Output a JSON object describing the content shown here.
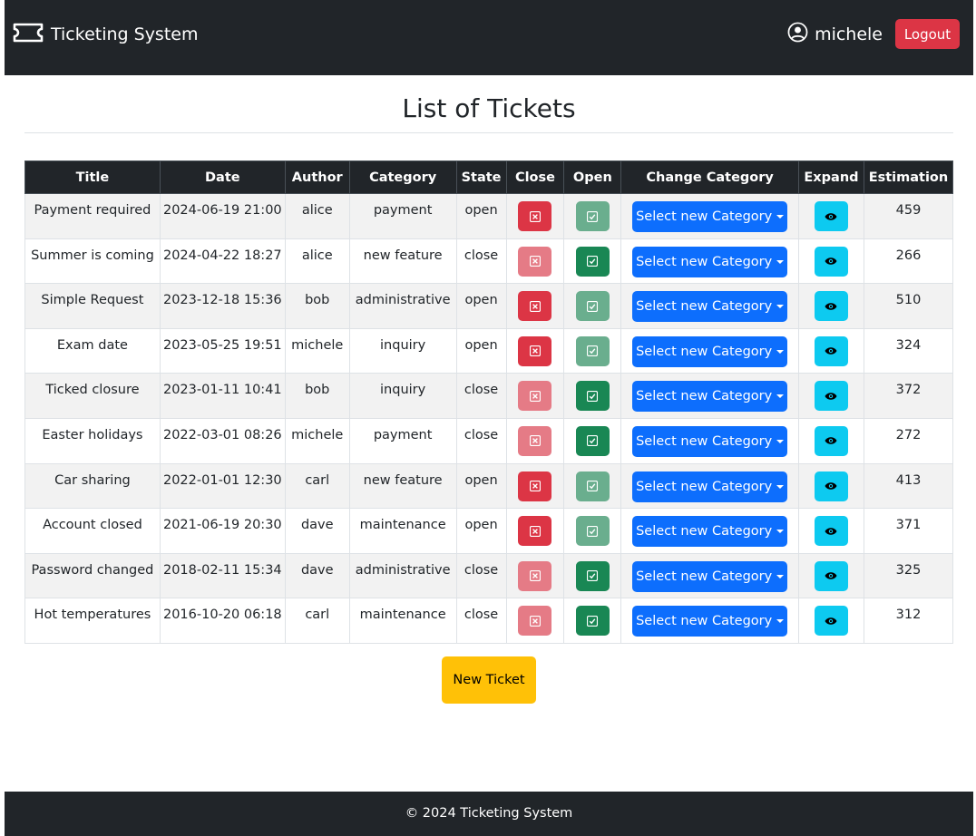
{
  "navbar": {
    "brand": "Ticketing System",
    "brand_icon": "ticket-icon",
    "user_icon": "person-circle-icon",
    "username": "michele",
    "logout_label": "Logout"
  },
  "page": {
    "title": "List of Tickets"
  },
  "table": {
    "headers": [
      "Title",
      "Date",
      "Author",
      "Category",
      "State",
      "Close",
      "Open",
      "Change Category",
      "Expand",
      "Estimation"
    ],
    "category_button_label": "Select new Category",
    "rows": [
      {
        "title": "Payment required",
        "date": "2024-06-19 21:00",
        "author": "alice",
        "category": "payment",
        "state": "open",
        "estimation": "459"
      },
      {
        "title": "Summer is coming",
        "date": "2024-04-22 18:27",
        "author": "alice",
        "category": "new feature",
        "state": "close",
        "estimation": "266"
      },
      {
        "title": "Simple Request",
        "date": "2023-12-18 15:36",
        "author": "bob",
        "category": "administrative",
        "state": "open",
        "estimation": "510"
      },
      {
        "title": "Exam date",
        "date": "2023-05-25 19:51",
        "author": "michele",
        "category": "inquiry",
        "state": "open",
        "estimation": "324"
      },
      {
        "title": "Ticked closure",
        "date": "2023-01-11 10:41",
        "author": "bob",
        "category": "inquiry",
        "state": "close",
        "estimation": "372"
      },
      {
        "title": "Easter holidays",
        "date": "2022-03-01 08:26",
        "author": "michele",
        "category": "payment",
        "state": "close",
        "estimation": "272"
      },
      {
        "title": "Car sharing",
        "date": "2022-01-01 12:30",
        "author": "carl",
        "category": "new feature",
        "state": "open",
        "estimation": "413"
      },
      {
        "title": "Account closed",
        "date": "2021-06-19 20:30",
        "author": "dave",
        "category": "maintenance",
        "state": "open",
        "estimation": "371"
      },
      {
        "title": "Password changed",
        "date": "2018-02-11 15:34",
        "author": "dave",
        "category": "administrative",
        "state": "close",
        "estimation": "325"
      },
      {
        "title": "Hot temperatures",
        "date": "2016-10-20 06:18",
        "author": "carl",
        "category": "maintenance",
        "state": "close",
        "estimation": "312"
      }
    ]
  },
  "actions": {
    "new_ticket_label": "New Ticket"
  },
  "footer": {
    "text": "© 2024 Ticketing System"
  },
  "colors": {
    "navbar_bg": "#212529",
    "danger": "#dc3545",
    "success": "#198754",
    "primary": "#0d6efd",
    "info": "#0dcaf0",
    "warning": "#ffc107"
  }
}
